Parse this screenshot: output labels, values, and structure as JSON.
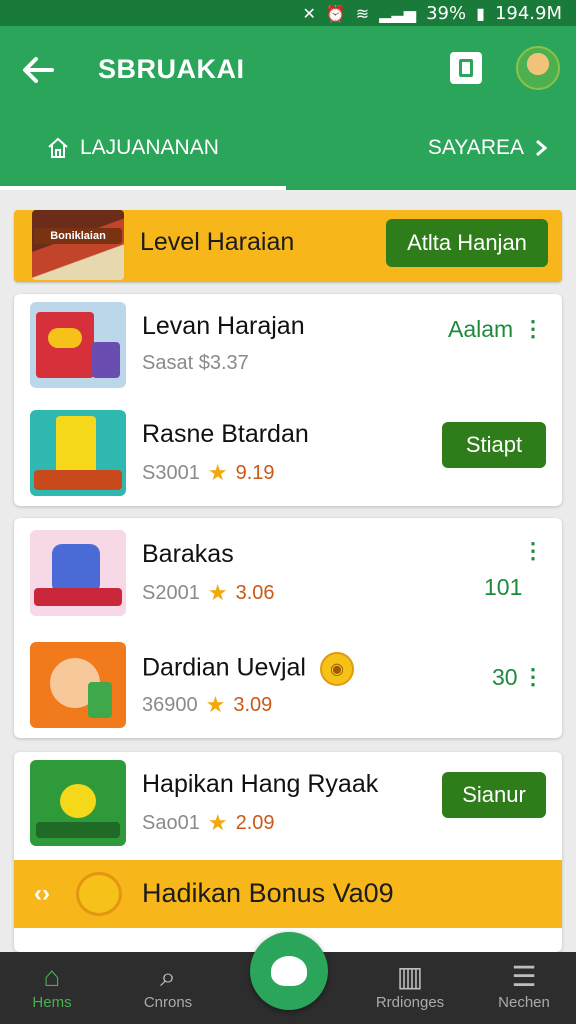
{
  "status_bar": {
    "battery": "39%",
    "time": "194.9M"
  },
  "app_bar": {
    "title": "SBRUAKAI"
  },
  "tabs": {
    "left": "LAJUANANAN",
    "right": "SAYAREA"
  },
  "banner": {
    "art_label": "Boniklaian",
    "label": "Level Haraian",
    "button": "Atlta Hanjan"
  },
  "items": [
    {
      "name": "Levan Harajan",
      "meta": "Sasat $3.37",
      "action": "Aalam"
    },
    {
      "name": "Rasne Btardan",
      "meta": "S3001",
      "rating": "9.19",
      "button": "Stiapt"
    },
    {
      "name": "Barakas",
      "meta": "S2001",
      "rating": "3.06",
      "action": "101"
    },
    {
      "name": "Dardian Uevjal",
      "meta": "36900",
      "rating": "3.09",
      "action": "30"
    },
    {
      "name": "Hapikan Hang Ryaak",
      "meta": "Sao01",
      "rating": "2.09",
      "button": "Sianur"
    }
  ],
  "bonus": {
    "label": "Hadikan Bonus Va09"
  },
  "nav": {
    "home": "Hems",
    "categories": "Cnrons",
    "rankings": "Rrdionges",
    "more": "Nechen"
  },
  "colors": {
    "primary_green": "#2aa55a",
    "dark_green": "#2e7d1a",
    "accent_yellow": "#f7b619"
  },
  "icons": [
    "back-arrow-icon",
    "square-icon",
    "avatar",
    "home-icon",
    "chevron-right-icon",
    "star-icon",
    "more-vert-icon",
    "coin-icon",
    "search-icon",
    "chat-icon",
    "ranking-icon",
    "menu-icon"
  ]
}
